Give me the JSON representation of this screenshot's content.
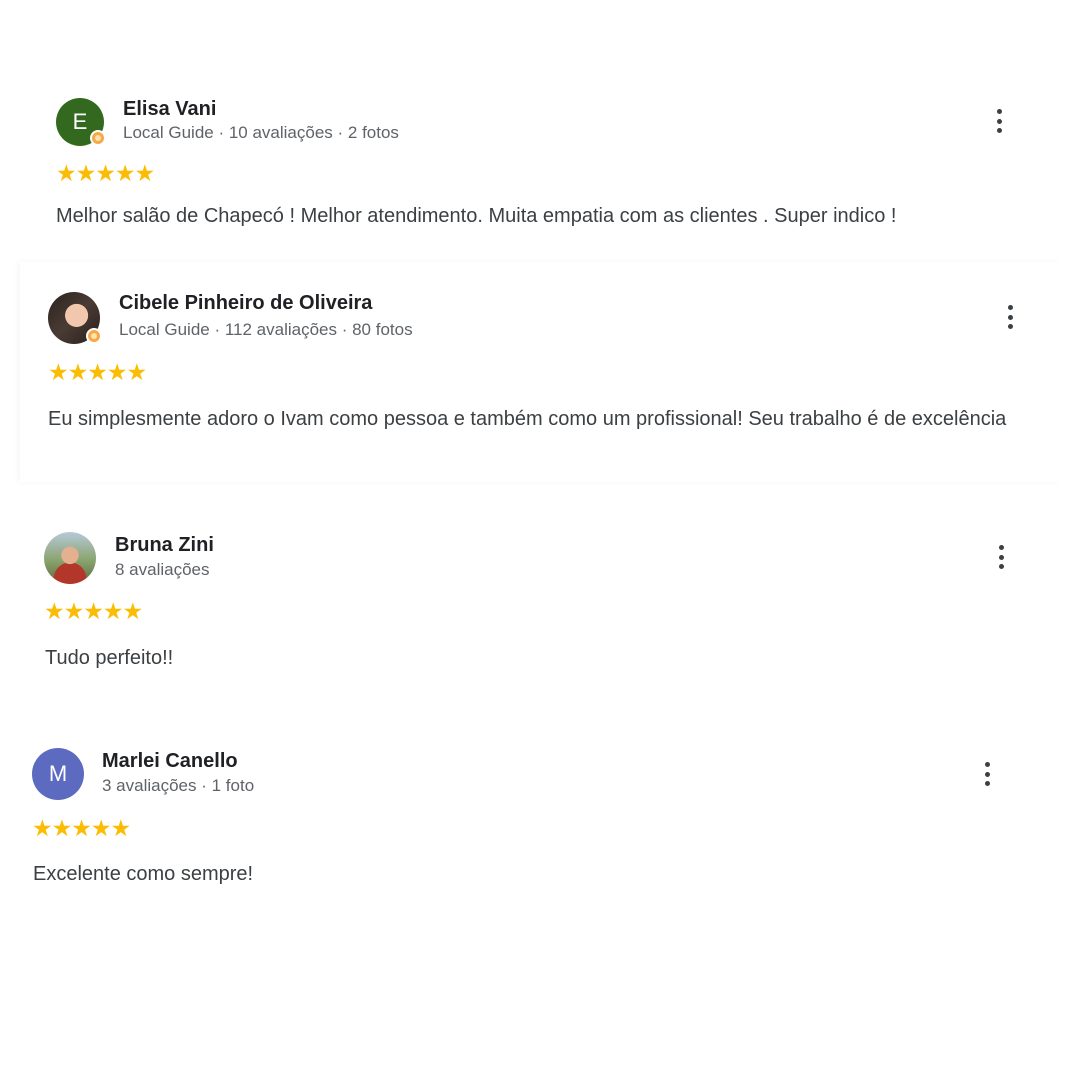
{
  "reviews": [
    {
      "name": "Elisa Vani",
      "meta": "Local Guide · 10 avaliações · 2 fotos",
      "avatar_initial": "E",
      "avatar_color": "#33691e",
      "stars": "★★★★★",
      "text": "Melhor salão de Chapecó ! Melhor atendimento. Muita empatia com as clientes . Super indico !"
    },
    {
      "name": "Cibele Pinheiro de Oliveira",
      "meta": "Local Guide · 112 avaliações · 80 fotos",
      "avatar_initial": "",
      "stars": "★★★★★",
      "text": "Eu simplesmente adoro o Ivam como pessoa e também como um profissional! Seu trabalho é de excelência"
    },
    {
      "name": "Bruna Zini",
      "meta": "8 avaliações",
      "avatar_initial": "",
      "stars": "★★★★★",
      "text": "Tudo perfeito!!"
    },
    {
      "name": "Marlei Canello",
      "meta": "3 avaliações · 1 foto",
      "avatar_initial": "M",
      "avatar_color": "#5c6bc0",
      "stars": "★★★★★",
      "text": "Excelente como sempre!"
    }
  ],
  "rating": 5,
  "icons": {
    "more": "more-vert-icon",
    "star": "star-icon",
    "local_guide_badge": "local-guide-badge-icon"
  },
  "colors": {
    "star": "#fbbc04",
    "name": "#202124",
    "meta": "#5f6368",
    "text": "#3c4043"
  }
}
